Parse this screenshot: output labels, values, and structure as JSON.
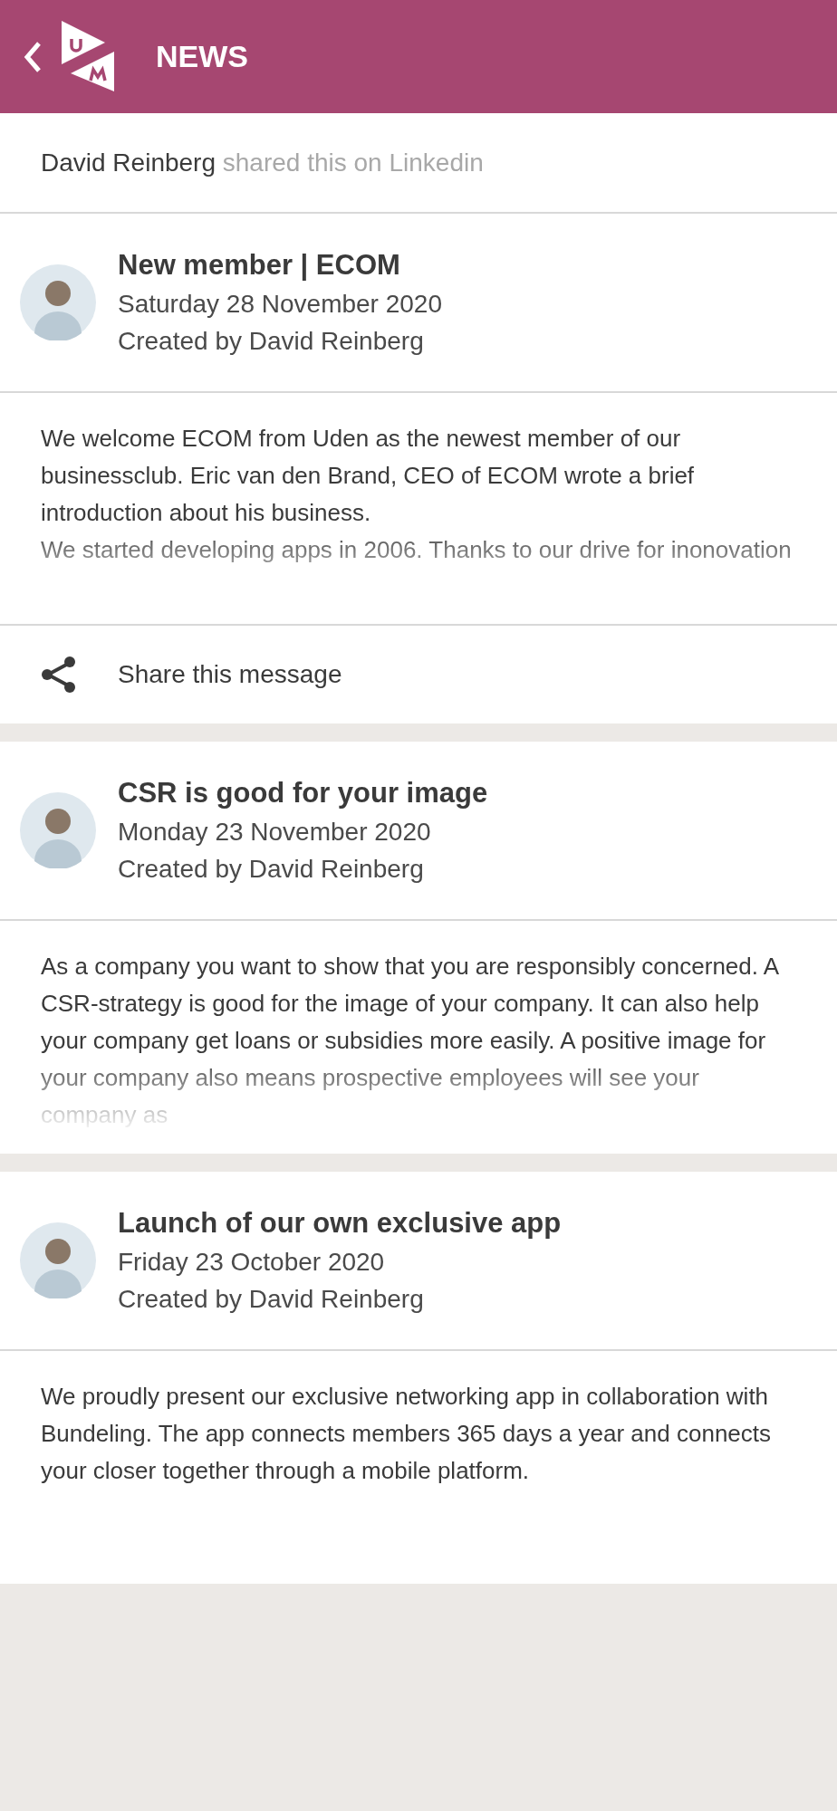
{
  "header": {
    "title": "NEWS"
  },
  "shared_by": {
    "name": "David Reinberg",
    "text": "shared this on Linkedin"
  },
  "articles": [
    {
      "title": "New member | ECOM",
      "date": "Saturday 28 November 2020",
      "author": "Created by David Reinberg",
      "body": "We welcome ECOM from Uden as the newest member of our businessclub. Eric van den Brand, CEO of ECOM wrote a brief introduction about his business.\nWe started developing apps in 2006. Thanks to our drive for inonovation",
      "share": "Share this message"
    },
    {
      "title": "CSR is good for your image",
      "date": "Monday 23 November 2020",
      "author": "Created by David Reinberg",
      "body": "As a company you want to show that you are responsibly concerned. A CSR-strategy is good for the image of your company. It can also help your company get loans or subsidies more easily. A positive image for your company also means prospective employees will see your company as"
    },
    {
      "title": "Launch of our own exclusive app",
      "date": "Friday 23 October 2020",
      "author": "Created by David Reinberg",
      "body": "We proudly present our exclusive networking app in collaboration with Bundeling. The app connects members 365 days a year and connects your closer together through a mobile platform."
    }
  ]
}
